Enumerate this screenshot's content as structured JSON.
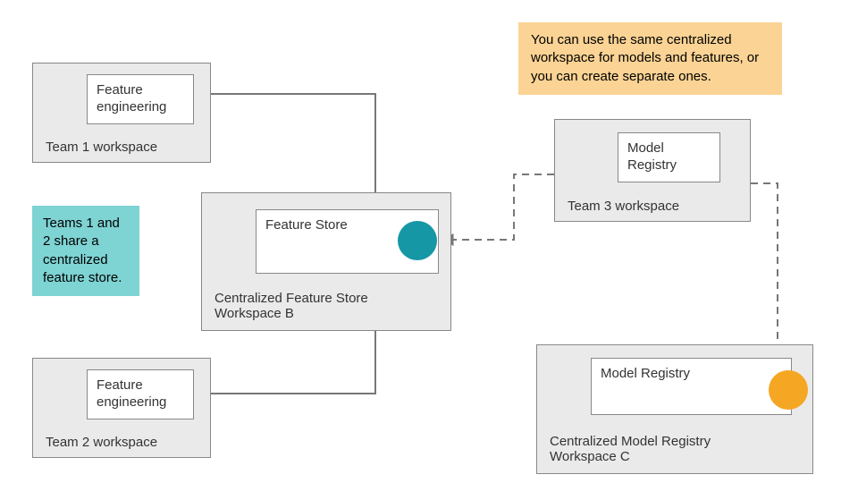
{
  "team1": {
    "label": "Team 1 workspace",
    "inner": "Feature\nengineering"
  },
  "team2": {
    "label": "Team 2 workspace",
    "inner": "Feature\nengineering"
  },
  "team3": {
    "label": "Team 3 workspace",
    "inner": "Model\nRegistry"
  },
  "feature_store_ws": {
    "label": "Centralized Feature Store\nWorkspace B",
    "inner": "Feature Store"
  },
  "model_registry_ws": {
    "label": "Centralized Model Registry\nWorkspace C",
    "inner": "Model Registry"
  },
  "note_teal": "Teams 1 and 2 share a centralized feature store.",
  "note_orange": "You can use the same centralized workspace for models and features, or you can create separate ones.",
  "colors": {
    "teal": "#1597a5",
    "orange": "#f5a623",
    "note_teal_bg": "#7ed3d3",
    "note_orange_bg": "#fbd394",
    "box_bg": "#eaeaea"
  }
}
